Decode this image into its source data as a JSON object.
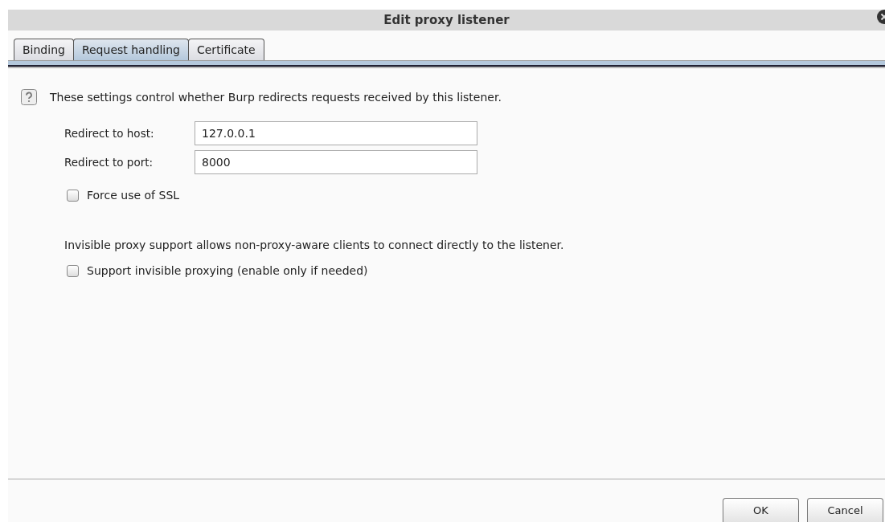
{
  "window": {
    "title": "Edit proxy listener"
  },
  "tabs": [
    {
      "label": "Binding",
      "selected": false
    },
    {
      "label": "Request handling",
      "selected": true
    },
    {
      "label": "Certificate",
      "selected": false
    }
  ],
  "intro": "These settings control whether Burp redirects requests received by this listener.",
  "fields": [
    {
      "label": "Redirect to host:",
      "value": "127.0.0.1"
    },
    {
      "label": "Redirect to port:",
      "value": "8000"
    }
  ],
  "force_ssl": {
    "label": "Force use of SSL",
    "checked": false
  },
  "invisible_note": "Invisible proxy support allows non-proxy-aware clients to connect directly to the listener.",
  "invisible": {
    "label": "Support invisible proxying (enable only if needed)",
    "checked": false
  },
  "buttons": [
    "OK",
    "Cancel"
  ]
}
